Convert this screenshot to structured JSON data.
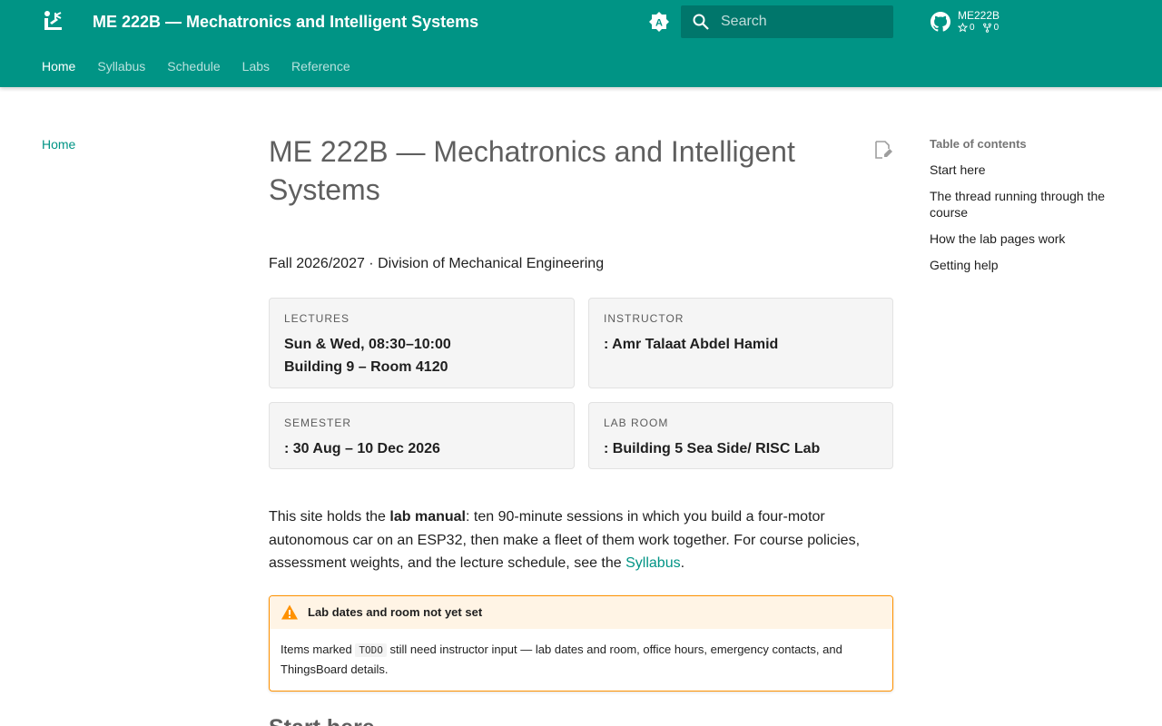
{
  "header": {
    "site_title": "ME 222B — Mechatronics and Intelligent Systems",
    "search_placeholder": "Search",
    "repo_name": "ME222B",
    "repo_stars": "0",
    "repo_forks": "0",
    "header_color": "#009485"
  },
  "tabs": [
    {
      "label": "Home",
      "active": true
    },
    {
      "label": "Syllabus"
    },
    {
      "label": "Schedule"
    },
    {
      "label": "Labs"
    },
    {
      "label": "Reference"
    }
  ],
  "left_nav": {
    "home": "Home"
  },
  "main": {
    "title": "ME 222B — Mechatronics and Intelligent Systems",
    "subtitle": "Fall 2026/2027 · Division of Mechanical Engineering",
    "cards": [
      {
        "label": "LECTURES",
        "lines": [
          "Sun & Wed, 08:30–10:00",
          "Building 9 – Room 4120"
        ]
      },
      {
        "label": "INSTRUCTOR",
        "lines": [
          ": Amr Talaat Abdel Hamid"
        ]
      },
      {
        "label": "SEMESTER",
        "lines": [
          ": 30 Aug – 10 Dec 2026"
        ]
      },
      {
        "label": "LAB ROOM",
        "lines": [
          ": Building 5 Sea Side/ RISC Lab"
        ]
      }
    ],
    "intro": {
      "before": "This site holds the ",
      "bold": "lab manual",
      "middle": ": ten 90-minute sessions in which you build a four-motor autonomous car on an ESP32, then make a fleet of them work together. For course policies, assessment weights, and the lecture schedule, see the ",
      "link": "Syllabus",
      "after": "."
    },
    "admonition": {
      "title": "Lab dates and room not yet set",
      "before": "Items marked ",
      "code": "TODO",
      "after": " still need instructor input — lab dates and room, office hours, emergency contacts, and ThingsBoard details.",
      "accent_color": "#ff9100"
    },
    "next_heading": "Start here"
  },
  "toc": {
    "title": "Table of contents",
    "items": [
      "Start here",
      "The thread running through the course",
      "How the lab pages work",
      "Getting help"
    ]
  }
}
